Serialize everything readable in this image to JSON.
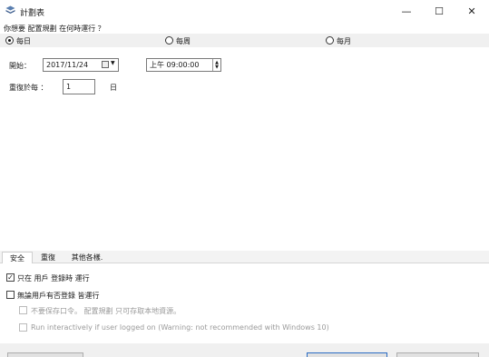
{
  "window": {
    "title": "計劃表",
    "minimize": "—",
    "maximize": "☐",
    "close": "✕"
  },
  "prompt": "你想要 配置規劃 在何時運行 ？",
  "frequency": {
    "options": [
      {
        "label": "每日",
        "selected": true
      },
      {
        "label": "每周",
        "selected": false
      },
      {
        "label": "每月",
        "selected": false
      }
    ]
  },
  "schedule": {
    "start_label": "開始：",
    "date_value": "2017/11/24",
    "time_value": "上午 09:00:00",
    "repeat_label": "重復於每 ：",
    "repeat_value": "1",
    "repeat_unit": "日"
  },
  "tabs": [
    "安全",
    "重復",
    "其他各樣."
  ],
  "security": {
    "run_only_logged_on": {
      "label": "只在 用戶 登錄時 運行",
      "checked": true
    },
    "run_whether_logged_on": {
      "label": "無論用戶有否登錄 皆運行",
      "checked": false
    },
    "do_not_store_password": {
      "label": "不要保存口令。 配置規劃 只可存取本地資源。",
      "checked": false
    },
    "run_interactively": {
      "label": "Run interactively if user logged on (Warning: not recommended with Windows 10)",
      "checked": false
    }
  },
  "colors": {
    "accent_button_border": "#2b6cc4",
    "panel_bg": "#f0f0f0"
  }
}
